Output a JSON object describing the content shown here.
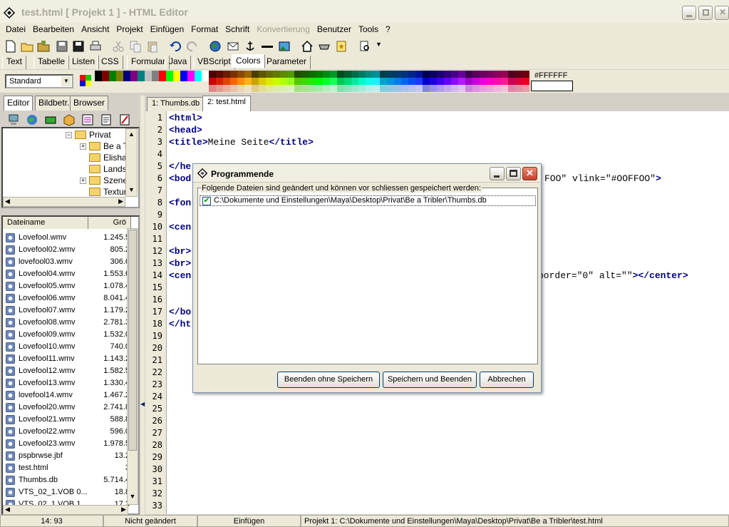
{
  "window": {
    "title": "test.html  [ Projekt 1 ] - HTML Editor"
  },
  "menu": [
    "Datei",
    "Bearbeiten",
    "Ansicht",
    "Projekt",
    "Einfügen",
    "Format",
    "Schrift",
    "Konvertierung",
    "Benutzer",
    "Tools",
    "?"
  ],
  "tabs_top": [
    "Text",
    "Tabelle",
    "Listen",
    "CSS",
    "Formular",
    "Java",
    "VBScript",
    "Colors",
    "Parameter"
  ],
  "color_toolbar": {
    "style_select": "Standard",
    "hex_value": "#FFFFFF"
  },
  "left_panel": {
    "tabs": [
      "Editor",
      "Bildbetr.",
      "Browser"
    ],
    "tree": [
      {
        "label": "Privat",
        "expander": "minus"
      },
      {
        "label": "Be a T",
        "expander": "plus"
      },
      {
        "label": "Elisha",
        "expander": ""
      },
      {
        "label": "Lands",
        "expander": ""
      },
      {
        "label": "Szene",
        "expander": "plus"
      },
      {
        "label": "Textur",
        "expander": ""
      }
    ],
    "file_columns": [
      "Dateiname",
      "Grö"
    ],
    "files": [
      {
        "name": "Lovefool.wmv",
        "size": "1.245.5"
      },
      {
        "name": "Lovefool02.wmv",
        "size": "805.2"
      },
      {
        "name": "lovefool03.wmv",
        "size": "306.6"
      },
      {
        "name": "Lovefool04.wmv",
        "size": "1.553.6"
      },
      {
        "name": "Lovefool05.wmv",
        "size": "1.078.4"
      },
      {
        "name": "Lovefool06.wmv",
        "size": "8.041.4"
      },
      {
        "name": "Lovefool07.wmv",
        "size": "1.179.2"
      },
      {
        "name": "Lovefool08.wmv",
        "size": "2.781.3"
      },
      {
        "name": "Lovefool09.wmv",
        "size": "1.532.0"
      },
      {
        "name": "Lovefool10.wmv",
        "size": "740.0"
      },
      {
        "name": "Lovefool11.wmv",
        "size": "1.143.2"
      },
      {
        "name": "Lovefool12.wmv",
        "size": "1.582.5"
      },
      {
        "name": "Lovefool13.wmv",
        "size": "1.330.4"
      },
      {
        "name": "lovefool14.wmv",
        "size": "1.467.2"
      },
      {
        "name": "Lovefool20.wmv",
        "size": "2.741.8"
      },
      {
        "name": "Lovefool21.wmv",
        "size": "588.8"
      },
      {
        "name": "Lovefool22.wmv",
        "size": "596.0"
      },
      {
        "name": "Lovefool23.wmv",
        "size": "1.978.5"
      },
      {
        "name": "pspbrwse.jbf",
        "size": "13.2"
      },
      {
        "name": "test.html",
        "size": "3"
      },
      {
        "name": "Thumbs.db",
        "size": "5.714.4"
      },
      {
        "name": "VTS_02_1.VOB 0...",
        "size": "18.8"
      },
      {
        "name": "VTS_02_1.VOB 1...",
        "size": "17.3"
      }
    ]
  },
  "editor": {
    "tabs": [
      "1: Thumbs.db",
      "2: test.html"
    ],
    "line_numbers": [
      "1",
      "2",
      "3",
      "4",
      "5",
      "6",
      "7",
      "8",
      "9",
      "10",
      "11",
      "12",
      "13",
      "14",
      "15",
      "16",
      "17",
      "18",
      "19",
      "20",
      "21",
      "22",
      "23",
      "24",
      "25",
      "26",
      "27",
      "28",
      "29",
      "30",
      "31",
      "32",
      "33"
    ],
    "lines": [
      {
        "n": 1,
        "text": "<html>"
      },
      {
        "n": 2,
        "text": "<head>"
      },
      {
        "n": 3,
        "text": "<title>Meine Seite</title>"
      },
      {
        "n": 5,
        "text": "</he"
      },
      {
        "n": 6,
        "text": "<bod"
      },
      {
        "n": 6,
        "text": "FOO\" vlink=\"#OOFFOO\">"
      },
      {
        "n": 8,
        "text": "<fon"
      },
      {
        "n": 10,
        "text": "<cen"
      },
      {
        "n": 12,
        "text": "<br>"
      },
      {
        "n": 13,
        "text": "<br>"
      },
      {
        "n": 14,
        "text": "<cen"
      },
      {
        "n": 14,
        "text": "border=\"0\" alt=\"\"></center>"
      },
      {
        "n": 17,
        "text": "</bo"
      },
      {
        "n": 18,
        "text": "</ht"
      }
    ]
  },
  "dialog": {
    "title": "Programmende",
    "hint": "Folgende Dateien sind geändert und können vor schliessen gespeichert werden:",
    "item": "C:\\Dokumente und Einstellungen\\Maya\\Desktop\\Privat\\Be a Tribler\\Thumbs.db",
    "buttons": {
      "quit_no_save": "Beenden ohne Speichern",
      "save_quit": "Speichern und Beenden",
      "cancel": "Abbrechen"
    }
  },
  "status": {
    "position": "14: 93",
    "modified": "Nicht geändert",
    "mode": "Einfügen",
    "path": "Projekt 1: C:\\Dokumente und Einstellungen\\Maya\\Desktop\\Privat\\Be a Tribler\\test.html"
  }
}
